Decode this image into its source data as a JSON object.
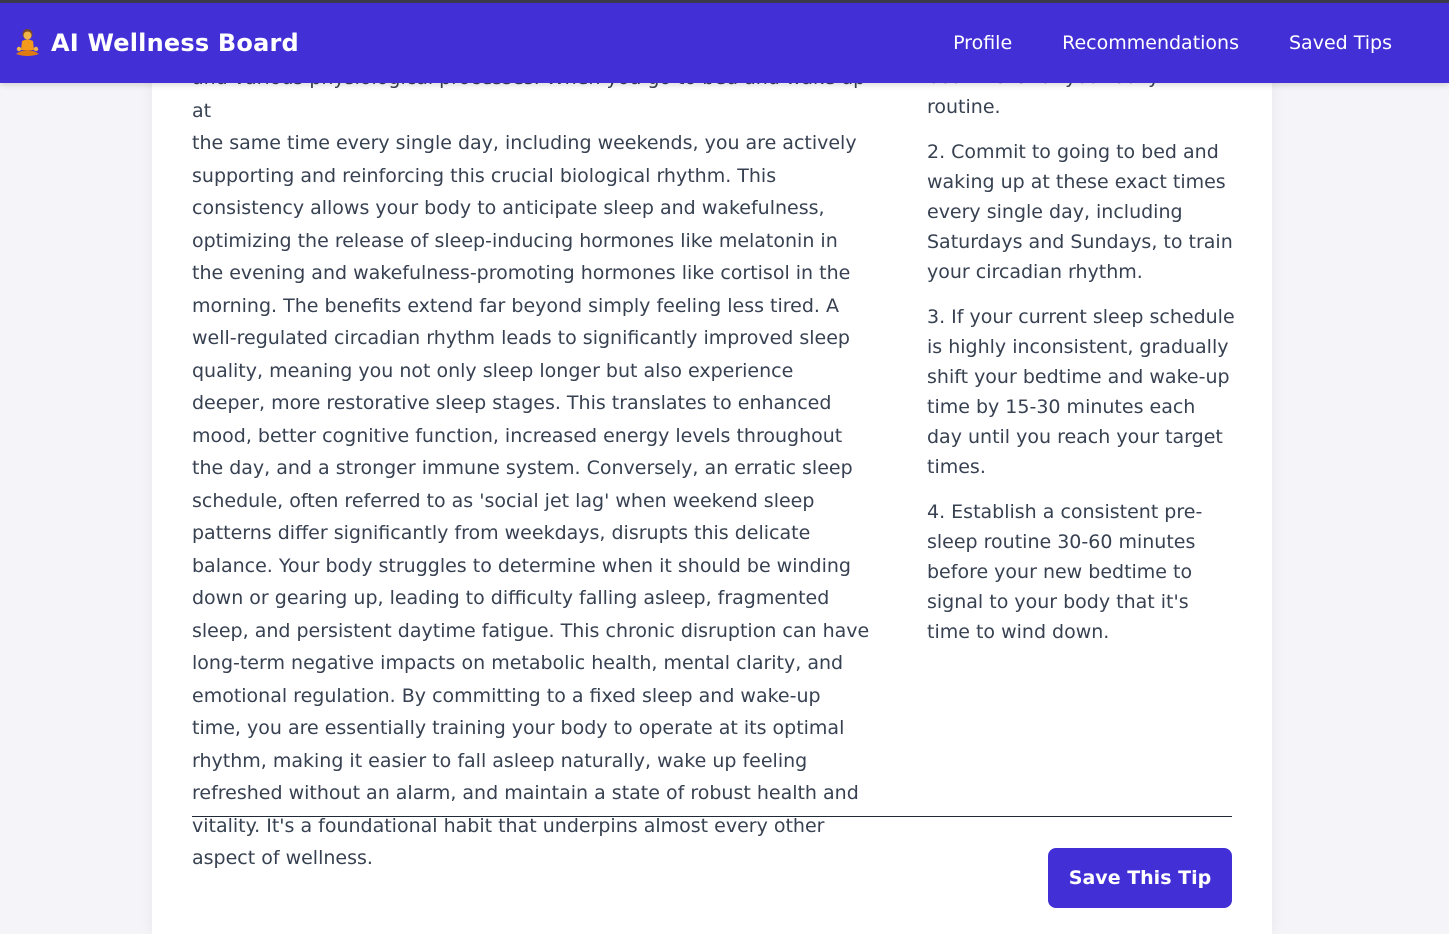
{
  "app": {
    "brand_icon": "meditation-icon",
    "brand_title": "AI Wellness Board"
  },
  "nav": {
    "items": [
      {
        "label": "Profile"
      },
      {
        "label": "Recommendations"
      },
      {
        "label": "Saved Tips"
      }
    ]
  },
  "tip": {
    "body_top_cut": "and various physiological processes. When you go to bed and wake up at",
    "body": "the same time every single day, including weekends, you are actively supporting and reinforcing this crucial biological rhythm. This consistency allows your body to anticipate sleep and wakefulness, optimizing the release of sleep-inducing hormones like melatonin in the evening and wakefulness-promoting hormones like cortisol in the morning. The benefits extend far beyond simply feeling less tired. A well-regulated circadian rhythm leads to significantly improved sleep quality, meaning you not only sleep longer but also experience deeper, more restorative sleep stages. This translates to enhanced mood, better cognitive function, increased energy levels throughout the day, and a stronger immune system. Conversely, an erratic sleep schedule, often referred to as 'social jet lag' when weekend sleep patterns differ significantly from weekdays, disrupts this delicate balance. Your body struggles to determine when it should be winding down or gearing up, leading to difficulty falling asleep, fragmented sleep, and persistent daytime fatigue. This chronic disruption can have long-term negative impacts on metabolic health, mental clarity, and emotional regulation. By committing to a fixed sleep and wake-up time, you are essentially training your body to operate at its optimal rhythm, making it easier to fall asleep naturally, wake up feeling refreshed without an alarm, and maintain a state of robust health and vitality. It's a foundational habit that underpins almost every other aspect of wellness.",
    "steps_top_cut": "bedtime is for your daily routine.",
    "steps": [
      "2. Commit to going to bed and waking up at these exact times every single day, including Saturdays and Sundays, to train your circadian rhythm.",
      "3. If your current sleep schedule is highly inconsistent, gradually shift your bedtime and wake-up time by 15-30 minutes each day until you reach your target times.",
      "4. Establish a consistent pre-sleep routine 30-60 minutes before your new bedtime to signal to your body that it's time to wind down."
    ],
    "save_label": "Save This Tip"
  },
  "colors": {
    "accent": "#4230d6",
    "background": "#f5f5f9",
    "card": "#ffffff",
    "text": "#374151"
  }
}
